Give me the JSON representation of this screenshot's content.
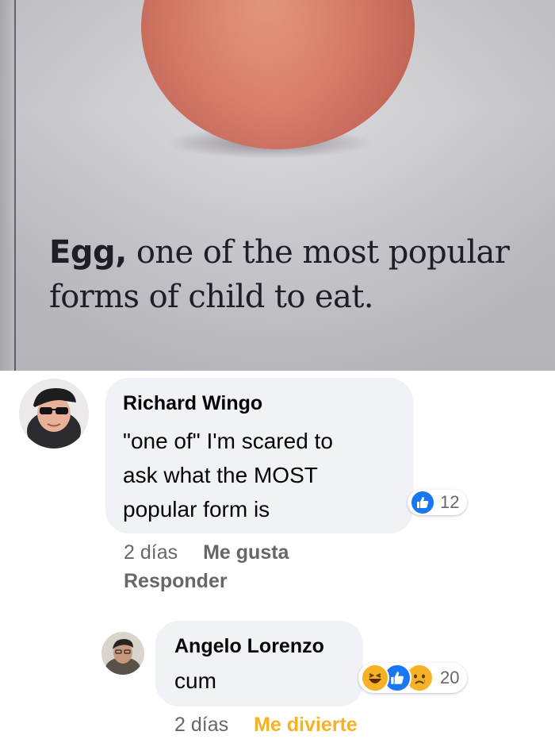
{
  "photo": {
    "caption_word": "Egg,",
    "caption_rest": " one of the most popular forms of child to eat."
  },
  "comments": [
    {
      "author": "Richard Wingo",
      "text_lines": [
        "\"one of\" I'm scared to",
        "ask what the MOST",
        "popular form is"
      ],
      "reaction_count": "12",
      "reaction_icons": [
        "like-icon"
      ],
      "time": "2 días",
      "like_label": "Me gusta",
      "reply_label": "Responder"
    },
    {
      "author": "Angelo Lorenzo",
      "text": "cum",
      "reaction_count": "20",
      "reaction_icons": [
        "haha-icon",
        "like-icon",
        "sad-icon"
      ],
      "time": "2 días",
      "reaction_label": "Me divierte"
    }
  ],
  "colors": {
    "bubble": "#f0f2f5",
    "like_blue": "#1877f2",
    "haha_yellow": "#f7b125",
    "meta_gray": "#65676b"
  }
}
